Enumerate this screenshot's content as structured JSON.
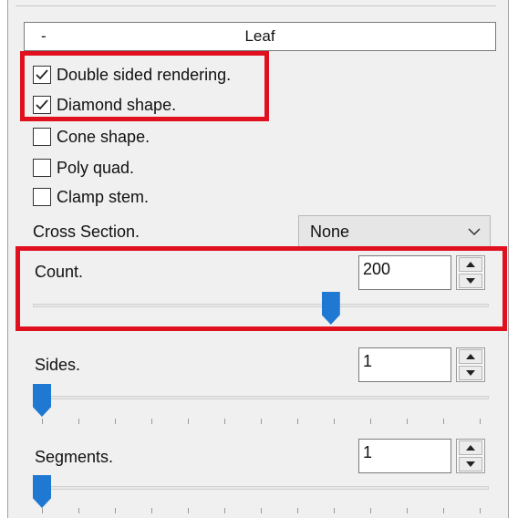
{
  "group": {
    "collapse_symbol": "-",
    "title": "Leaf"
  },
  "checkboxes": [
    {
      "label": "Double sided rendering.",
      "checked": true
    },
    {
      "label": "Diamond shape.",
      "checked": true
    },
    {
      "label": "Cone shape.",
      "checked": false
    },
    {
      "label": "Poly quad.",
      "checked": false
    },
    {
      "label": "Clamp stem.",
      "checked": false
    }
  ],
  "cross_section": {
    "label": "Cross Section.",
    "value": "None"
  },
  "count": {
    "label": "Count.",
    "value": "200",
    "slider_fraction": 0.66
  },
  "sides": {
    "label": "Sides.",
    "value": "1",
    "slider_fraction": 0.0
  },
  "segments": {
    "label": "Segments.",
    "value": "1",
    "slider_fraction": 0.0
  },
  "colors": {
    "highlight": "#e0101e",
    "slider_thumb": "#1f78d1",
    "panel": "#f0f0f0"
  },
  "icons": {
    "checkbox_check": "checkmark-icon",
    "dropdown": "chevron-down-icon",
    "spin_up": "triangle-up-icon",
    "spin_down": "triangle-down-icon"
  }
}
